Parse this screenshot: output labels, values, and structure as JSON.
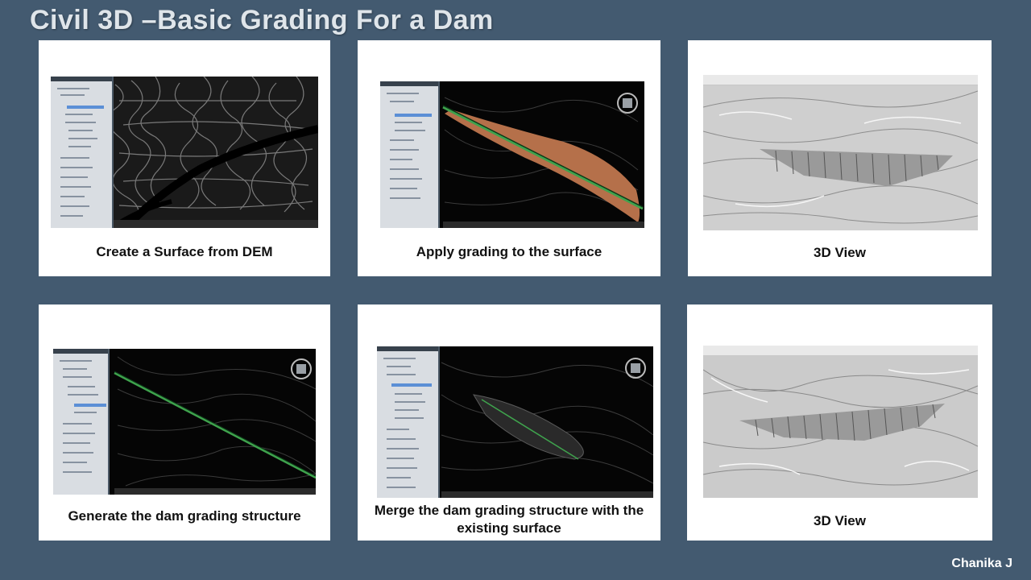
{
  "slide": {
    "title": "Civil 3D –Basic Grading For a Dam",
    "author": "Chanika J"
  },
  "cards": [
    {
      "caption": "Create a Surface from DEM",
      "icon": "dem-surface-screenshot"
    },
    {
      "caption": "Apply grading to the surface",
      "icon": "grading-screenshot"
    },
    {
      "caption": "3D View",
      "icon": "3d-view-screenshot"
    },
    {
      "caption": "Generate the dam grading structure",
      "icon": "dam-structure-screenshot"
    },
    {
      "caption": "Merge the dam grading structure with the existing surface",
      "icon": "merge-surface-screenshot"
    },
    {
      "caption": "3D View",
      "icon": "3d-view-screenshot"
    }
  ],
  "colors": {
    "background": "#435a70",
    "card": "#ffffff",
    "grading_fill": "#b5704a",
    "feature_line": "#3fa34d"
  }
}
